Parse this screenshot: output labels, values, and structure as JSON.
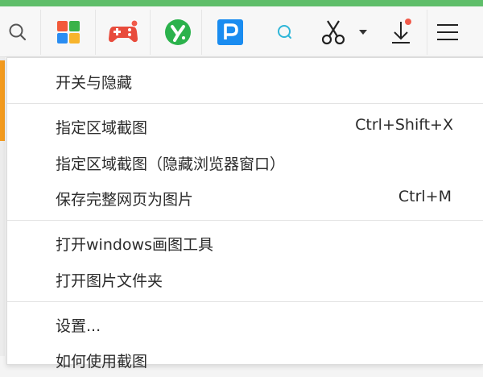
{
  "toolbar": {
    "icons": [
      "search-icon",
      "app-grid-icon",
      "game-controller-icon",
      "green-y-app-icon",
      "p-app-icon",
      "search-small-icon",
      "scissors-icon",
      "caret-down-icon",
      "download-icon",
      "hamburger-menu-icon"
    ],
    "colors": {
      "accent": "#5fbe6a",
      "game": "#e84b3c",
      "y_app": "#2bb24c",
      "p_app": "#1a8cf0",
      "scissors": "#222222",
      "badge": "#f15a4a"
    }
  },
  "menu": {
    "items": [
      {
        "label": "开关与隐藏",
        "shortcut": ""
      },
      {
        "label": "指定区域截图",
        "shortcut": "Ctrl+Shift+X"
      },
      {
        "label": "指定区域截图（隐藏浏览器窗口）",
        "shortcut": ""
      },
      {
        "label": "保存完整网页为图片",
        "shortcut": "Ctrl+M"
      },
      {
        "label": "打开windows画图工具",
        "shortcut": ""
      },
      {
        "label": "打开图片文件夹",
        "shortcut": ""
      },
      {
        "label": "设置...",
        "shortcut": ""
      },
      {
        "label": "如何使用截图",
        "shortcut": ""
      }
    ]
  }
}
